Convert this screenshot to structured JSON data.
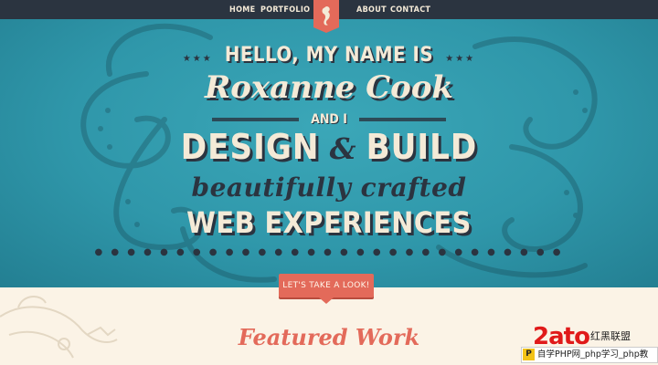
{
  "nav": {
    "items": [
      {
        "label": "HOME"
      },
      {
        "label": "PORTFOLIO"
      },
      {
        "label": "ABOUT"
      },
      {
        "label": "CONTACT"
      }
    ],
    "logo_icon": "seahorse-icon"
  },
  "hero": {
    "greeting": "HELLO, MY NAME IS",
    "name": "Roxanne Cook",
    "and_i": "AND I",
    "design_build": {
      "design": "DESIGN",
      "amp": "&",
      "build": "BUILD"
    },
    "tagline": "beautifully crafted",
    "experiences": "WEB EXPERIENCES",
    "cta": "LET'S TAKE A LOOK!"
  },
  "featured": {
    "title": "Featured Work"
  },
  "watermark": {
    "brand": "2ato",
    "chinese": "红黑联盟",
    "bar_text": "自学PHP网_php学习_php教"
  },
  "colors": {
    "hero_bg": "#2f97aa",
    "cream": "#f4ead7",
    "coral": "#e36a5a",
    "navy": "#2b3440"
  }
}
